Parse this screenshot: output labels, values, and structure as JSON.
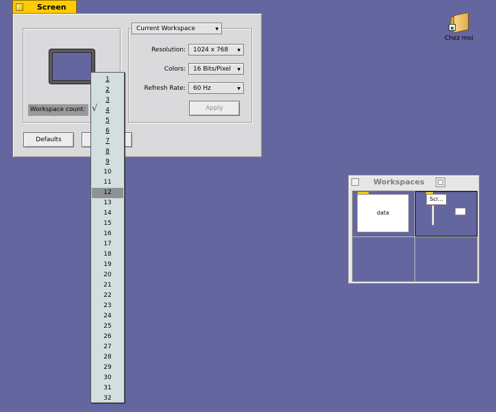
{
  "screen_window": {
    "title": "Screen",
    "workspace_dropdown": "Current Workspace",
    "workspace_count_label": "Workspace count:",
    "resolution_label": "Resolution:",
    "resolution_value": "1024 x 768",
    "colors_label": "Colors:",
    "colors_value": "16 Bits/Pixel",
    "refresh_label": "Refresh Rate:",
    "refresh_value": "60 Hz",
    "apply_label": "Apply",
    "defaults_label": "Defaults",
    "revert_label": ""
  },
  "workspace_menu": {
    "items": [
      "1",
      "2",
      "3",
      "4",
      "5",
      "6",
      "7",
      "8",
      "9",
      "10",
      "11",
      "12",
      "13",
      "14",
      "15",
      "16",
      "17",
      "18",
      "19",
      "20",
      "21",
      "22",
      "23",
      "24",
      "25",
      "26",
      "27",
      "28",
      "29",
      "30",
      "31",
      "32"
    ],
    "checked": "4",
    "highlighted": "12",
    "check_glyph": "√"
  },
  "workspaces_window": {
    "title": "Workspaces",
    "mini_window_1": "data",
    "mini_window_2": "Scr..."
  },
  "desktop": {
    "icon_label": "Chez moi"
  },
  "colors": {
    "desktop": "#6466a0",
    "title_tab": "#ffcb00",
    "highlight": "#8d9294"
  }
}
